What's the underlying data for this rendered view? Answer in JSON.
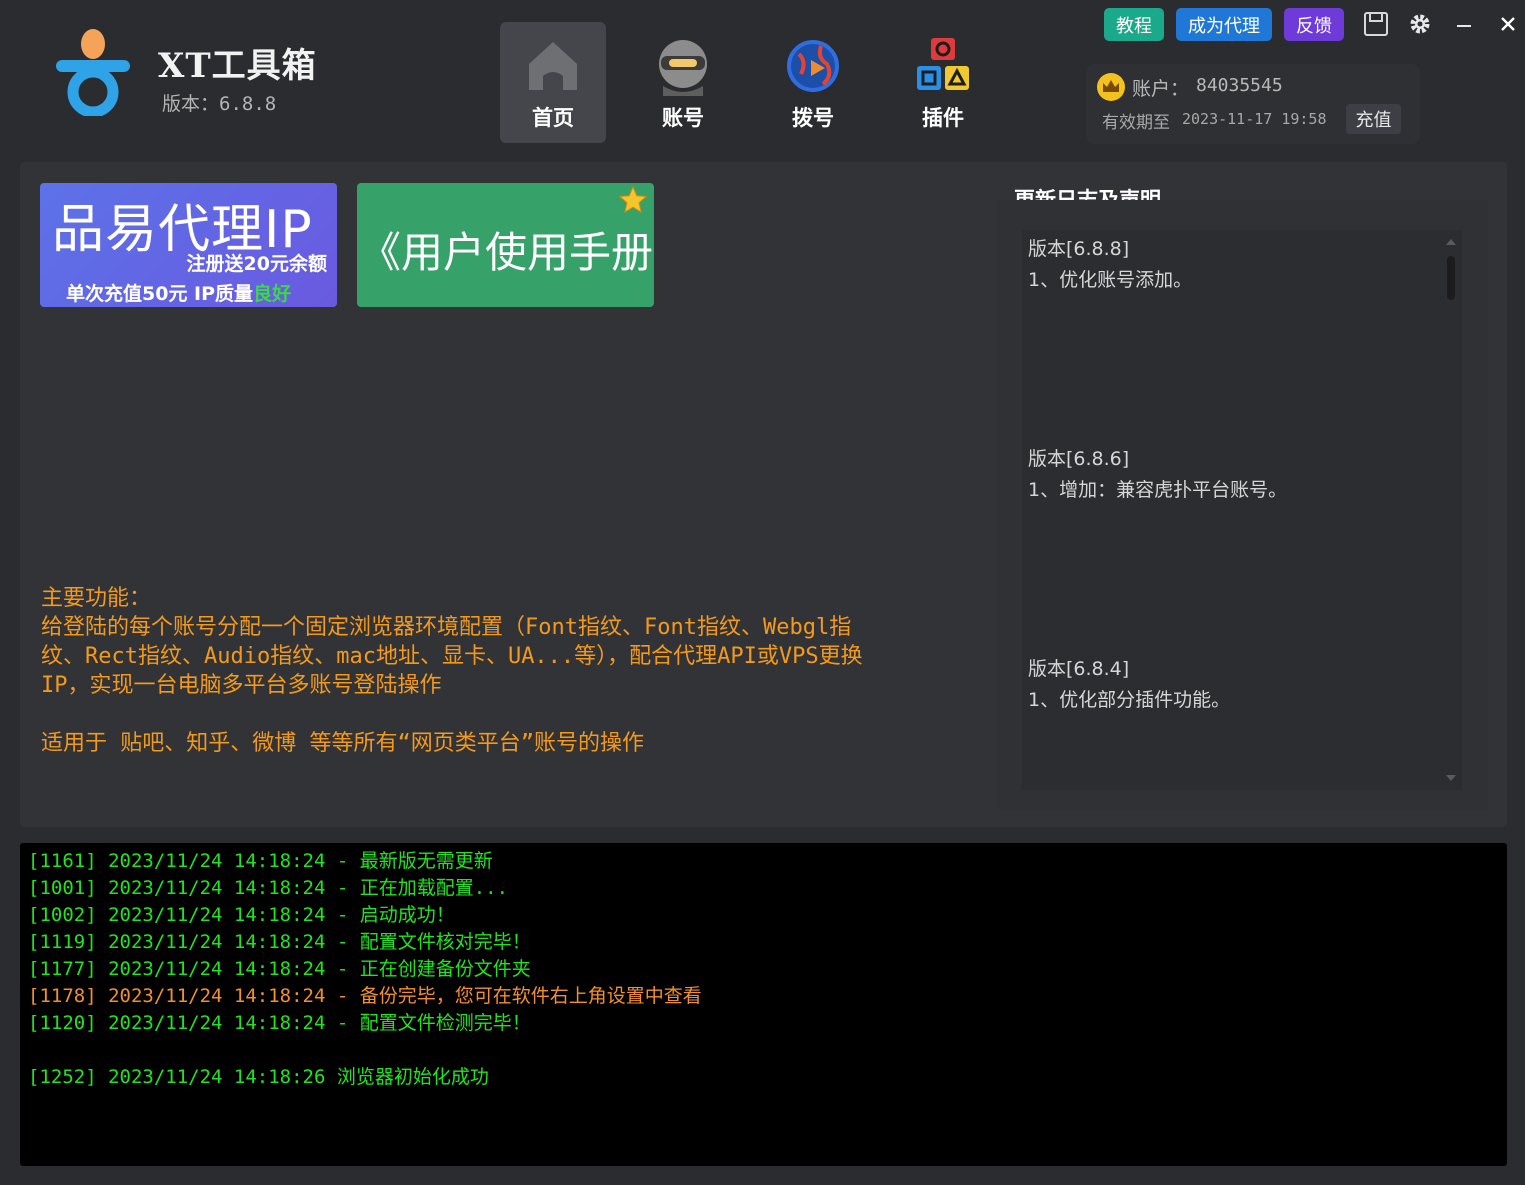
{
  "app": {
    "title": "XT工具箱",
    "version_label": "版本：6.8.8"
  },
  "nav": [
    {
      "label": "首页",
      "icon": "home-icon",
      "active": true
    },
    {
      "label": "账号",
      "icon": "ninja-avatar-icon",
      "active": false
    },
    {
      "label": "拨号",
      "icon": "dial-globe-icon",
      "active": false
    },
    {
      "label": "插件",
      "icon": "plugin-blocks-icon",
      "active": false
    }
  ],
  "top_buttons": {
    "tutorial": {
      "label": "教程",
      "color": "#1aa98a"
    },
    "agent": {
      "label": "成为代理",
      "color": "#1f78d6"
    },
    "feedback": {
      "label": "反馈",
      "color": "#6e3ad8"
    }
  },
  "window_controls": [
    "save-icon",
    "gear-icon",
    "minimize-icon",
    "close-icon"
  ],
  "account": {
    "label": "账户：",
    "id": "84035545",
    "expire_label": "有效期至",
    "expire_value": "2023-11-17 19:58",
    "recharge_label": "充值"
  },
  "banners": {
    "proxy": {
      "title": "品易代理IP",
      "line1": "注册送20元余额",
      "line2_prefix": "单次充值50元 IP质量",
      "line2_good": "良好"
    },
    "manual": {
      "title": "《用户使用手册》"
    }
  },
  "features": {
    "heading": "主要功能：",
    "line1": "给登陆的每个账号分配一个固定浏览器环境配置（Font指纹、Font指纹、Webgl指",
    "line2": "纹、Rect指纹、Audio指纹、mac地址、显卡、UA...等），配合代理API或VPS更换",
    "line3": "IP，实现一台电脑多平台多账号登陆操作",
    "applicable": "适用于 贴吧、知乎、微博  等等所有“网页类平台”账号的操作"
  },
  "changelog": {
    "title": "更新日志及声明",
    "entries": [
      {
        "version": "版本[6.8.8]",
        "note": "1、优化账号添加。"
      },
      {
        "version": "版本[6.8.6]",
        "note": "1、增加：兼容虎扑平台账号。"
      },
      {
        "version": "版本[6.8.4]",
        "note": "1、优化部分插件功能。"
      }
    ]
  },
  "log": [
    {
      "text": "[1161] 2023/11/24 14:18:24 - 最新版无需更新",
      "level": "ok"
    },
    {
      "text": "[1001] 2023/11/24 14:18:24 - 正在加载配置...",
      "level": "ok"
    },
    {
      "text": "[1002] 2023/11/24 14:18:24 - 启动成功！",
      "level": "ok"
    },
    {
      "text": "[1119] 2023/11/24 14:18:24 - 配置文件核对完毕！",
      "level": "ok"
    },
    {
      "text": "[1177] 2023/11/24 14:18:24 - 正在创建备份文件夹",
      "level": "ok"
    },
    {
      "text": "[1178] 2023/11/24 14:18:24 - 备份完毕，您可在软件右上角设置中查看",
      "level": "warn"
    },
    {
      "text": "[1120] 2023/11/24 14:18:24 - 配置文件检测完毕！",
      "level": "ok"
    },
    {
      "text": "",
      "level": "blank"
    },
    {
      "text": "[1252] 2023/11/24 14:18:26 浏览器初始化成功",
      "level": "ok"
    }
  ]
}
